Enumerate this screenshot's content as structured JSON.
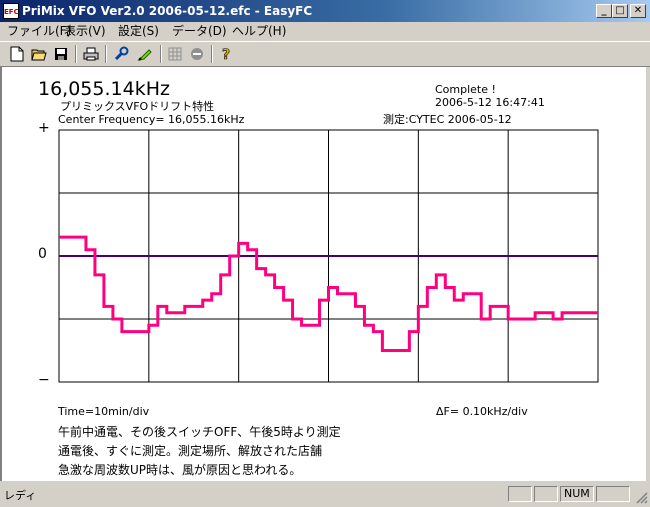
{
  "window": {
    "title": "PriMix VFO Ver2.0 2006-05-12.efc - EasyFC",
    "icon_label": "EFC"
  },
  "caption_buttons": {
    "minimize": "_",
    "maximize": "□",
    "close": "✕"
  },
  "menu": [
    {
      "label": "ファイル(F)"
    },
    {
      "label": "表示(V)"
    },
    {
      "label": "設定(S)"
    },
    {
      "label": "データ(D)"
    },
    {
      "label": "ヘルプ(H)"
    }
  ],
  "toolbar": {
    "buttons": [
      "new-file-icon",
      "open-folder-icon",
      "save-icon",
      "print-icon",
      "wrench-icon",
      "marker-icon",
      "grid-icon",
      "stop-icon",
      "help-icon"
    ]
  },
  "display": {
    "frequency": "16,055.14kHz",
    "subtitle": "プリミックスVFOドリフト特性",
    "center_frequency": "Center Frequency= 16,055.16kHz",
    "status": "Complete !",
    "datetime": "2006-5-12  16:47:41",
    "measured_by": "測定:CYTEC  2006-05-12",
    "y_label_plus": "+",
    "y_label_zero": "0",
    "y_label_minus": "−",
    "time_div": "Time=10min/div",
    "delta_f": "ΔF=     0.10kHz/div",
    "notes": [
      "午前中通電、その後スイッチOFF、午後5時より測定",
      "通電後、すぐに測定。測定場所、解放された店舗",
      "急激な周波数UP時は、風が原因と思われる。"
    ]
  },
  "chart_data": {
    "type": "line",
    "x_unit": "min",
    "y_unit": "kHz",
    "xlim": [
      0,
      60
    ],
    "ylim": [
      -0.2,
      0.2
    ],
    "x": [
      0,
      1,
      2,
      3,
      4,
      5,
      6,
      7,
      8,
      9,
      10,
      11,
      12,
      13,
      14,
      15,
      16,
      17,
      18,
      19,
      20,
      21,
      22,
      23,
      24,
      25,
      26,
      27,
      28,
      29,
      30,
      31,
      32,
      33,
      34,
      35,
      36,
      37,
      38,
      39,
      40,
      41,
      42,
      43,
      44,
      45,
      46,
      47,
      48,
      49,
      50,
      51,
      52,
      53,
      54,
      55,
      56,
      57,
      58,
      59,
      60
    ],
    "values": [
      0.03,
      0.03,
      0.03,
      0.01,
      -0.03,
      -0.08,
      -0.1,
      -0.12,
      -0.12,
      -0.12,
      -0.11,
      -0.08,
      -0.09,
      -0.09,
      -0.08,
      -0.08,
      -0.07,
      -0.06,
      -0.03,
      0.0,
      0.02,
      0.01,
      -0.02,
      -0.03,
      -0.05,
      -0.07,
      -0.1,
      -0.11,
      -0.11,
      -0.07,
      -0.05,
      -0.06,
      -0.06,
      -0.08,
      -0.11,
      -0.12,
      -0.15,
      -0.15,
      -0.15,
      -0.12,
      -0.08,
      -0.05,
      -0.03,
      -0.05,
      -0.07,
      -0.06,
      -0.06,
      -0.1,
      -0.08,
      -0.08,
      -0.1,
      -0.1,
      -0.1,
      -0.09,
      -0.09,
      -0.1,
      -0.09,
      -0.09,
      -0.09,
      -0.09,
      -0.09
    ],
    "zero_line": 0,
    "grid": true
  },
  "statusbar": {
    "text": "レディ",
    "num": "NUM"
  },
  "colors": {
    "trace": "#ff0080",
    "zero_line": "#400080",
    "grid": "#000000",
    "client_bg": "#ffffff"
  }
}
